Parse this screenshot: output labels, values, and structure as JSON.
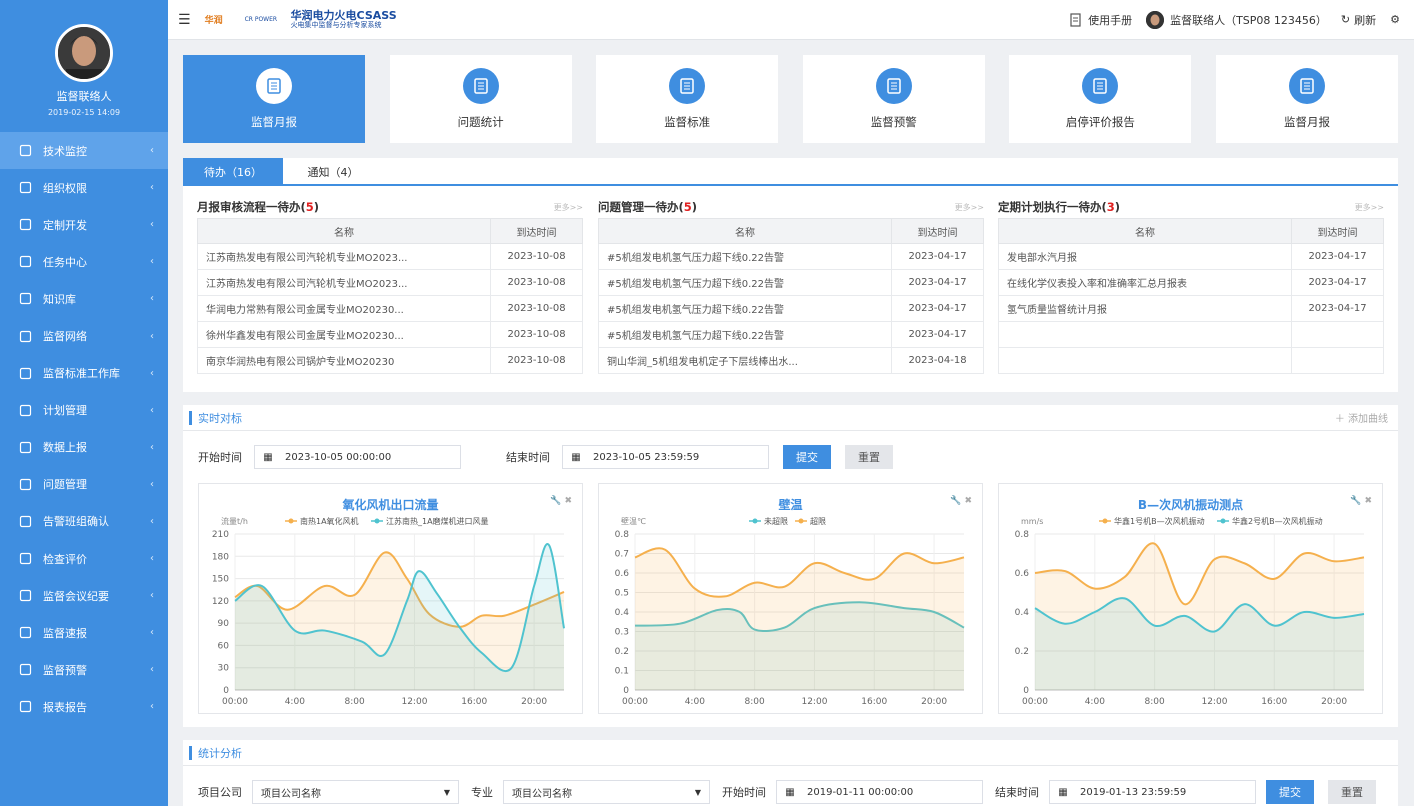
{
  "user": {
    "name": "监督联络人",
    "datetime": "2019-02-15 14:09"
  },
  "sidebar": {
    "items": [
      {
        "label": "技术监控",
        "icon": "home-icon",
        "active": true
      },
      {
        "label": "组织权限",
        "icon": "org-icon"
      },
      {
        "label": "定制开发",
        "icon": "monitor-icon"
      },
      {
        "label": "任务中心",
        "icon": "grid-icon"
      },
      {
        "label": "知识库",
        "icon": "book-icon"
      },
      {
        "label": "监督网络",
        "icon": "globe-icon"
      },
      {
        "label": "监督标准工作库",
        "icon": "archive-icon"
      },
      {
        "label": "计划管理",
        "icon": "plan-icon"
      },
      {
        "label": "数据上报",
        "icon": "cube-icon"
      },
      {
        "label": "问题管理",
        "icon": "doc-icon"
      },
      {
        "label": "告警班组确认",
        "icon": "alarm-icon"
      },
      {
        "label": "检查评价",
        "icon": "check-icon"
      },
      {
        "label": "监督会议纪要",
        "icon": "meeting-icon"
      },
      {
        "label": "监督速报",
        "icon": "report-icon"
      },
      {
        "label": "监督预警",
        "icon": "warning-icon"
      },
      {
        "label": "报表报告",
        "icon": "table-icon"
      }
    ]
  },
  "header": {
    "logo_a": "华润",
    "logo_b": "CR POWER",
    "title": "华润电力火电CSASS",
    "subtitle": "火电集中监督与分析专家系统",
    "manual": "使用手册",
    "user_label": "监督联络人（TSP08 123456）",
    "refresh": "刷新"
  },
  "cards": [
    {
      "label": "监督月报",
      "active": true
    },
    {
      "label": "问题统计"
    },
    {
      "label": "监督标准"
    },
    {
      "label": "监督预警"
    },
    {
      "label": "启停评价报告"
    },
    {
      "label": "监督月报"
    }
  ],
  "tabs": [
    {
      "label": "待办（16）",
      "active": true
    },
    {
      "label": "通知（4）"
    }
  ],
  "panels": [
    {
      "title": "月报审核流程一待办(",
      "count": "5",
      "close": ")",
      "more": "更多>>",
      "col1": "名称",
      "col2": "到达时间",
      "rows": [
        [
          "江苏南热发电有限公司汽轮机专业MO2023...",
          "2023-10-08"
        ],
        [
          "江苏南热发电有限公司汽轮机专业MO2023...",
          "2023-10-08"
        ],
        [
          "华润电力常熟有限公司金属专业MO20230...",
          "2023-10-08"
        ],
        [
          "徐州华鑫发电有限公司金属专业MO20230...",
          "2023-10-08"
        ],
        [
          "南京华润热电有限公司锅炉专业MO20230",
          "2023-10-08"
        ]
      ]
    },
    {
      "title": "问题管理一待办(",
      "count": "5",
      "close": ")",
      "more": "更多>>",
      "col1": "名称",
      "col2": "到达时间",
      "rows": [
        [
          "#5机组发电机氢气压力超下线0.22告警",
          "2023-04-17"
        ],
        [
          "#5机组发电机氢气压力超下线0.22告警",
          "2023-04-17"
        ],
        [
          "#5机组发电机氢气压力超下线0.22告警",
          "2023-04-17"
        ],
        [
          "#5机组发电机氢气压力超下线0.22告警",
          "2023-04-17"
        ],
        [
          "铜山华润_5机组发电机定子下层线棒出水...",
          "2023-04-18"
        ]
      ]
    },
    {
      "title": "定期计划执行一待办(",
      "count": "3",
      "close": ")",
      "more": "更多>>",
      "col1": "名称",
      "col2": "到达时间",
      "rows": [
        [
          "发电部水汽月报",
          "2023-04-17"
        ],
        [
          "在线化学仪表投入率和准确率汇总月报表",
          "2023-04-17"
        ],
        [
          "氢气质量监督统计月报",
          "2023-04-17"
        ],
        [
          "",
          ""
        ],
        [
          "",
          ""
        ]
      ]
    }
  ],
  "realtime": {
    "title": "实时对标",
    "add_curve": "添加曲线",
    "start_label": "开始时间",
    "start_value": "2023-10-05 00:00:00",
    "end_label": "结束时间",
    "end_value": "2023-10-05  23:59:59",
    "submit": "提交",
    "reset": "重置"
  },
  "chart_data": [
    {
      "type": "area",
      "title": "氧化风机出口流量",
      "ylabel": "流量t/h",
      "x_ticks": [
        "00:00",
        "4:00",
        "8:00",
        "12:00",
        "16:00",
        "20:00"
      ],
      "y_ticks": [
        "0",
        "30",
        "60",
        "90",
        "120",
        "150",
        "180",
        "210"
      ],
      "ylim": [
        0,
        210
      ],
      "series": [
        {
          "name": "南热1A氧化风机",
          "color": "#f5b04d",
          "values": [
            [
              0,
              125
            ],
            [
              1.5,
              140
            ],
            [
              3.5,
              108
            ],
            [
              6,
              140
            ],
            [
              8,
              128
            ],
            [
              10,
              185
            ],
            [
              11.5,
              150
            ],
            [
              13,
              102
            ],
            [
              15,
              85
            ],
            [
              16.5,
              100
            ],
            [
              18,
              100
            ],
            [
              20,
              115
            ],
            [
              22,
              132
            ]
          ]
        },
        {
          "name": "江苏南热_1A磨煤机进口风量",
          "color": "#4fc3cf",
          "values": [
            [
              0,
              120
            ],
            [
              1.8,
              140
            ],
            [
              4,
              80
            ],
            [
              6,
              80
            ],
            [
              8.5,
              65
            ],
            [
              10,
              48
            ],
            [
              11.5,
              120
            ],
            [
              12.3,
              160
            ],
            [
              13.5,
              130
            ],
            [
              15,
              85
            ],
            [
              16.5,
              50
            ],
            [
              18.5,
              30
            ],
            [
              20,
              140
            ],
            [
              21,
              195
            ],
            [
              22,
              83
            ]
          ]
        }
      ]
    },
    {
      "type": "area",
      "title": "壁温",
      "ylabel": "壁温℃",
      "x_ticks": [
        "00:00",
        "4:00",
        "8:00",
        "12:00",
        "16:00",
        "20:00"
      ],
      "y_ticks": [
        "0",
        "0.1",
        "0.2",
        "0.3",
        "0.4",
        "0.5",
        "0.6",
        "0.7",
        "0.8"
      ],
      "ylim": [
        0,
        0.8
      ],
      "series": [
        {
          "name": "未超限",
          "color": "#4fc3cf",
          "values": [
            [
              0,
              0.33
            ],
            [
              3,
              0.34
            ],
            [
              5.5,
              0.41
            ],
            [
              7,
              0.4
            ],
            [
              8,
              0.31
            ],
            [
              10,
              0.32
            ],
            [
              12,
              0.42
            ],
            [
              15,
              0.45
            ],
            [
              18,
              0.42
            ],
            [
              20,
              0.4
            ],
            [
              22,
              0.32
            ]
          ]
        },
        {
          "name": "超限",
          "color": "#f5b04d",
          "values": [
            [
              0,
              0.68
            ],
            [
              2,
              0.72
            ],
            [
              4,
              0.52
            ],
            [
              6,
              0.48
            ],
            [
              8,
              0.55
            ],
            [
              10,
              0.53
            ],
            [
              12,
              0.65
            ],
            [
              14,
              0.6
            ],
            [
              16,
              0.57
            ],
            [
              18,
              0.7
            ],
            [
              20,
              0.65
            ],
            [
              22,
              0.68
            ]
          ]
        }
      ]
    },
    {
      "type": "area",
      "title": "B—次风机振动测点",
      "ylabel": "mm/s",
      "x_ticks": [
        "00:00",
        "4:00",
        "8:00",
        "12:00",
        "16:00",
        "20:00"
      ],
      "y_ticks": [
        "0",
        "0.2",
        "0.4",
        "0.6",
        "0.8"
      ],
      "ylim": [
        0,
        0.8
      ],
      "series": [
        {
          "name": "华鑫1号机B—次风机振动",
          "color": "#f5b04d",
          "values": [
            [
              0,
              0.6
            ],
            [
              2,
              0.61
            ],
            [
              4,
              0.52
            ],
            [
              6,
              0.58
            ],
            [
              8,
              0.75
            ],
            [
              10,
              0.44
            ],
            [
              12,
              0.67
            ],
            [
              14,
              0.65
            ],
            [
              16,
              0.57
            ],
            [
              18,
              0.7
            ],
            [
              20,
              0.66
            ],
            [
              22,
              0.68
            ]
          ]
        },
        {
          "name": "华鑫2号机B—次风机振动",
          "color": "#4fc3cf",
          "values": [
            [
              0,
              0.42
            ],
            [
              2,
              0.34
            ],
            [
              4,
              0.4
            ],
            [
              6,
              0.47
            ],
            [
              8,
              0.33
            ],
            [
              10,
              0.38
            ],
            [
              12,
              0.3
            ],
            [
              14,
              0.44
            ],
            [
              16,
              0.33
            ],
            [
              18,
              0.4
            ],
            [
              20,
              0.37
            ],
            [
              22,
              0.39
            ]
          ]
        }
      ]
    }
  ],
  "stats": {
    "title": "统计分析",
    "company_label": "项目公司",
    "company_value": "项目公司名称",
    "major_label": "专业",
    "major_value": "项目公司名称",
    "start_label": "开始时间",
    "start_value": "2019-01-11  00:00:00",
    "end_label": "结束时间",
    "end_value": "2019-01-13  23:59:59",
    "submit": "提交",
    "reset": "重置"
  }
}
